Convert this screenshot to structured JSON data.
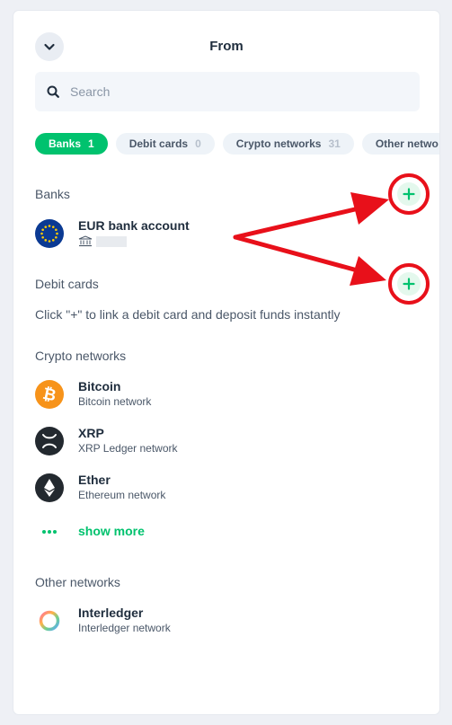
{
  "header": {
    "title": "From"
  },
  "search": {
    "placeholder": "Search"
  },
  "chips": [
    {
      "label": "Banks",
      "count": "1",
      "active": true
    },
    {
      "label": "Debit cards",
      "count": "0",
      "active": false
    },
    {
      "label": "Crypto networks",
      "count": "31",
      "active": false
    },
    {
      "label": "Other netwo",
      "count": "",
      "active": false
    }
  ],
  "banks": {
    "title": "Banks",
    "items": [
      {
        "name": "EUR bank account",
        "icon": "eu-flag-icon"
      }
    ]
  },
  "debit_cards": {
    "title": "Debit cards",
    "hint": "Click \"+\" to link a debit card and deposit funds instantly"
  },
  "crypto": {
    "title": "Crypto networks",
    "items": [
      {
        "name": "Bitcoin",
        "sub": "Bitcoin network",
        "icon": "bitcoin-icon"
      },
      {
        "name": "XRP",
        "sub": "XRP Ledger network",
        "icon": "xrp-icon"
      },
      {
        "name": "Ether",
        "sub": "Ethereum network",
        "icon": "ether-icon"
      }
    ],
    "show_more": "show more"
  },
  "other": {
    "title": "Other networks",
    "items": [
      {
        "name": "Interledger",
        "sub": "Interledger network",
        "icon": "interledger-icon"
      }
    ]
  },
  "colors": {
    "accent": "#00c26e",
    "annotation": "#e8101a",
    "bitcoin": "#f7931a",
    "xrp": "#23292f",
    "eu_blue": "#0b3a93"
  }
}
